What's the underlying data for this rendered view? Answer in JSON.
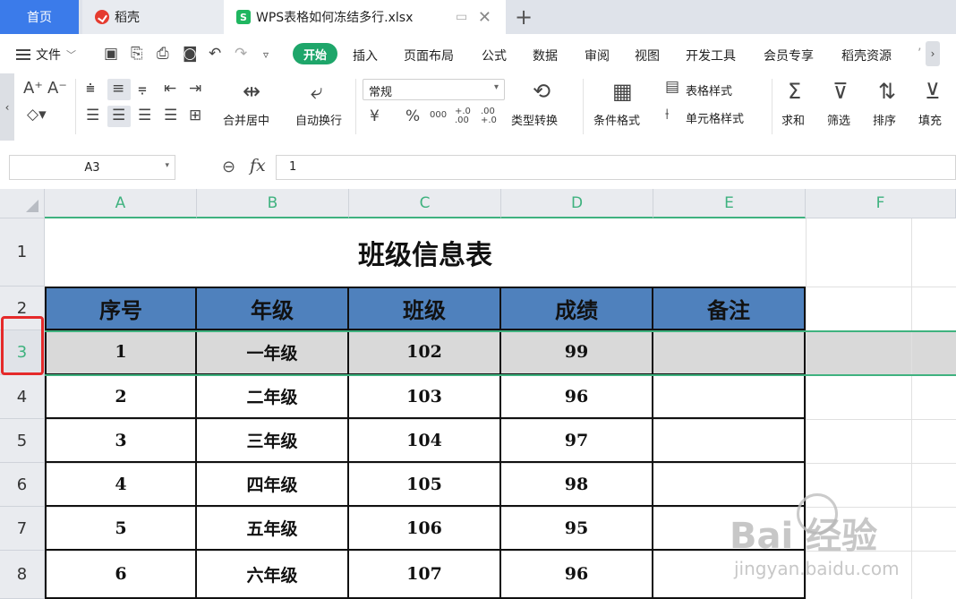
{
  "tabs": {
    "home": "首页",
    "docer": "稻壳",
    "file": "WPS表格如何冻结多行.xlsx",
    "file_icon": "S"
  },
  "menu": {
    "file": "文件",
    "items": [
      "开始",
      "插入",
      "页面布局",
      "公式",
      "数据",
      "审阅",
      "视图",
      "开发工具",
      "会员专享",
      "稻壳资源"
    ]
  },
  "ribbon": {
    "merge_center": "合并居中",
    "wrap_text": "自动换行",
    "number_format": "常规",
    "type_convert": "类型转换",
    "cond_format": "条件格式",
    "table_style": "表格样式",
    "cell_style": "单元格样式",
    "sum": "求和",
    "filter": "筛选",
    "sort": "排序",
    "fill": "填充",
    "currency": "¥",
    "percent": "%",
    "thousands": "000",
    "dec_inc": "+.0 .00",
    "dec_dec": ".00 +.0"
  },
  "formula_bar": {
    "cell_ref": "A3",
    "fx": "fx",
    "value": "1"
  },
  "columns": [
    "A",
    "B",
    "C",
    "D",
    "E",
    "F"
  ],
  "rows": [
    "1",
    "2",
    "3",
    "4",
    "5",
    "6",
    "7",
    "8"
  ],
  "selected_row": "3",
  "sheet": {
    "title": "班级信息表",
    "headers": [
      "序号",
      "年级",
      "班级",
      "成绩",
      "备注"
    ],
    "data": [
      [
        "1",
        "一年级",
        "102",
        "99",
        ""
      ],
      [
        "2",
        "二年级",
        "103",
        "96",
        ""
      ],
      [
        "3",
        "三年级",
        "104",
        "97",
        ""
      ],
      [
        "4",
        "四年级",
        "105",
        "98",
        ""
      ],
      [
        "5",
        "五年级",
        "106",
        "95",
        ""
      ],
      [
        "6",
        "六年级",
        "107",
        "96",
        ""
      ]
    ]
  },
  "watermark": {
    "main": "Bai 经验",
    "sub": "jingyan.baidu.com"
  },
  "colors": {
    "accent_green": "#1ea66a",
    "header_fill": "#4f81bd",
    "selection_line": "#3fb27f",
    "highlight_box": "#e52a2a",
    "home_tab": "#3b7bea"
  }
}
